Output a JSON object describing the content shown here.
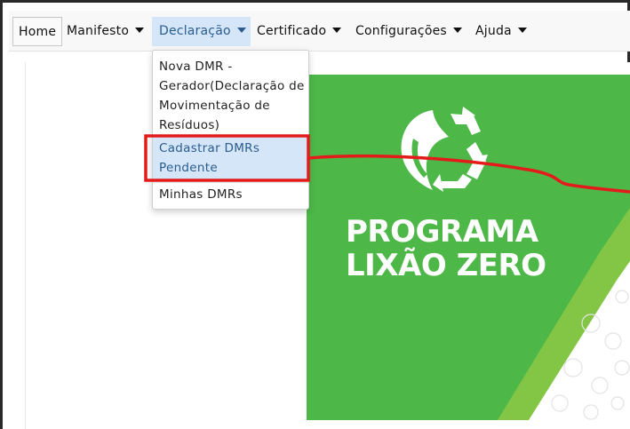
{
  "navbar": {
    "items": [
      {
        "label": "Home"
      },
      {
        "label": "Manifesto"
      },
      {
        "label": "Declaração"
      },
      {
        "label": "Certificado"
      },
      {
        "label": "Configurações"
      },
      {
        "label": "Ajuda"
      }
    ]
  },
  "dropdown": {
    "items": [
      {
        "label_lines": [
          "Nova DMR -",
          "Gerador(Declaração de",
          "Movimentação de",
          "Resíduos)"
        ]
      },
      {
        "label_lines": [
          "Cadastrar DMRs",
          "Pendente"
        ],
        "highlighted": true
      },
      {
        "label_lines": [
          "Minhas DMRs"
        ]
      }
    ]
  },
  "banner": {
    "title_lines": [
      "PROGRAMA",
      "LIXÃO ZERO"
    ],
    "background_color": "#4db848"
  },
  "annotation": {
    "color": "#e31b1b"
  },
  "colors": {
    "active_nav": "#d4e6f7",
    "active_text": "#2a5d8f"
  }
}
